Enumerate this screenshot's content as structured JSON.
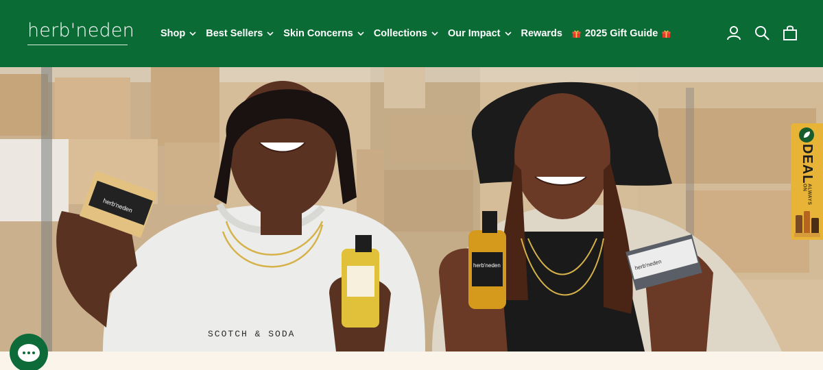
{
  "brand": {
    "logo_text": "herb'neden"
  },
  "nav": {
    "items": [
      {
        "label": "Shop",
        "has_dropdown": true
      },
      {
        "label": "Best Sellers",
        "has_dropdown": true
      },
      {
        "label": "Skin Concerns",
        "has_dropdown": true
      },
      {
        "label": "Collections",
        "has_dropdown": true
      },
      {
        "label": "Our Impact",
        "has_dropdown": true
      },
      {
        "label": "Rewards",
        "has_dropdown": false
      },
      {
        "label": "2025 Gift Guide",
        "has_dropdown": false
      }
    ]
  },
  "header_icons": [
    "account-icon",
    "search-icon",
    "cart-icon"
  ],
  "hero": {
    "shirt_text": "SCOTCH & SODA",
    "product_label": "herb'neden"
  },
  "deal_tab": {
    "small_text": "ALWAYS ON",
    "big_text": "DEAL"
  },
  "colors": {
    "header_bg": "#0a6b35",
    "deal_tab": "#e8b437",
    "chat_bg": "#0c6b38",
    "page_bg": "#fbf4ea"
  }
}
